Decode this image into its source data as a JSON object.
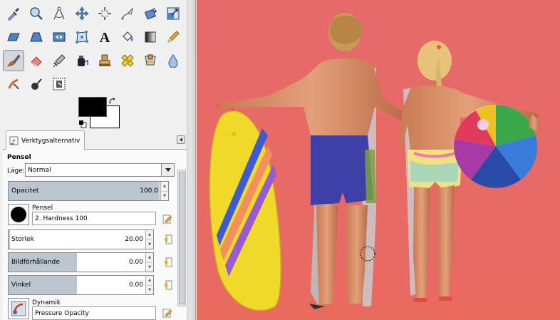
{
  "tools": [
    {
      "name": "eyedropper-icon",
      "row": 0,
      "col": 0
    },
    {
      "name": "zoom-icon",
      "row": 0,
      "col": 1
    },
    {
      "name": "measure-icon",
      "row": 0,
      "col": 2
    },
    {
      "name": "move-icon",
      "row": 0,
      "col": 3
    },
    {
      "name": "align-icon",
      "row": 0,
      "col": 4
    },
    {
      "name": "path-icon",
      "row": 0,
      "col": 5
    },
    {
      "name": "rotate-icon",
      "row": 0,
      "col": 6
    },
    {
      "name": "scale-icon",
      "row": 0,
      "col": 7
    },
    {
      "name": "shear-icon",
      "row": 1,
      "col": 0
    },
    {
      "name": "perspective-icon",
      "row": 1,
      "col": 1
    },
    {
      "name": "flip-icon",
      "row": 1,
      "col": 2
    },
    {
      "name": "cage-icon",
      "row": 1,
      "col": 3
    },
    {
      "name": "text-icon",
      "row": 1,
      "col": 4
    },
    {
      "name": "bucket-fill-icon",
      "row": 1,
      "col": 5
    },
    {
      "name": "gradient-icon",
      "row": 1,
      "col": 6
    },
    {
      "name": "pencil-icon",
      "row": 1,
      "col": 7
    },
    {
      "name": "paintbrush-icon",
      "row": 2,
      "col": 0,
      "active": true
    },
    {
      "name": "eraser-icon",
      "row": 2,
      "col": 1
    },
    {
      "name": "airbrush-icon",
      "row": 2,
      "col": 2
    },
    {
      "name": "ink-icon",
      "row": 2,
      "col": 3
    },
    {
      "name": "clone-icon",
      "row": 2,
      "col": 4
    },
    {
      "name": "heal-icon",
      "row": 2,
      "col": 5
    },
    {
      "name": "perspective-clone-icon",
      "row": 2,
      "col": 6
    },
    {
      "name": "blur-icon",
      "row": 2,
      "col": 7
    },
    {
      "name": "smudge-icon",
      "row": 3,
      "col": 0
    },
    {
      "name": "dodge-burn-icon",
      "row": 3,
      "col": 1
    },
    {
      "name": "foreground-select-icon",
      "row": 3,
      "col": 2
    }
  ],
  "colors": {
    "foreground": "#000000",
    "background": "#ffffff"
  },
  "tab": {
    "label": "Verktygsalternativ",
    "icon": "tool-options-icon"
  },
  "options": {
    "tool_name": "Pensel",
    "mode_label": "Läge:",
    "mode_value": "Normal",
    "opacity": {
      "label": "Opacitet",
      "value": "100.0",
      "fraction": 1.0
    },
    "brush": {
      "label": "Pensel",
      "value": "2. Hardness 100"
    },
    "size": {
      "label": "Storlek",
      "value": "20.00",
      "fraction": 0.0
    },
    "aspect": {
      "label": "Bildförhållande",
      "value": "0.00",
      "fraction": 0.5
    },
    "angle": {
      "label": "Vinkel",
      "value": "0.00",
      "fraction": 0.5
    },
    "dynamics": {
      "label": "Dynamik",
      "value": "Pressure Opacity"
    }
  }
}
